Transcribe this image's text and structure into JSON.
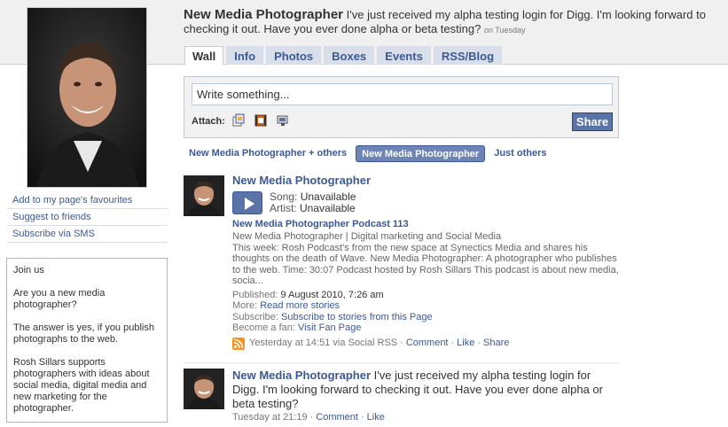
{
  "colors": {
    "link": "#3b5998",
    "tab_bg": "#d8dfea",
    "share_bg": "#5b74a8",
    "filter_active": "#6d84b4",
    "rss": "#f7931e"
  },
  "header": {
    "name": "New Media Photographer",
    "status": "I've just received my alpha testing login for Digg. I'm looking forward to checking it out. Have you ever done alpha or beta testing?",
    "time": "on Tuesday"
  },
  "tabs": [
    {
      "label": "Wall",
      "active": true
    },
    {
      "label": "Info"
    },
    {
      "label": "Photos"
    },
    {
      "label": "Boxes"
    },
    {
      "label": "Events"
    },
    {
      "label": "RSS/Blog"
    }
  ],
  "left": {
    "links": [
      "Add to my page's favourites",
      "Suggest to friends",
      "Subscribe via SMS"
    ],
    "join": {
      "title": "Join us",
      "q": "Are you a new media photographer?",
      "a": "The answer is yes, if you publish photographs to the web.",
      "desc": "Rosh Sillars supports photographers with ideas about social media, digital media and new marketing for the photographer."
    }
  },
  "composer": {
    "placeholder": "Write something...",
    "attach_label": "Attach:",
    "attach_icons": [
      "photo-icon",
      "video-icon",
      "link-icon"
    ],
    "share_label": "Share"
  },
  "filter": [
    "New Media Photographer + others",
    "New Media Photographer",
    "Just others"
  ],
  "stories": [
    {
      "name": "New Media Photographer",
      "song_label": "Song:",
      "song_value": "Unavailable",
      "artist_label": "Artist:",
      "artist_value": "Unavailable",
      "podcast_title": "New Media Photographer Podcast 113",
      "source": "New Media Photographer | Digital marketing and Social Media",
      "description": "This week: Rosh Podcast's from the new space at Synectics Media and shares his thoughts on the death of Wave. New Media Photographer: A photographer who publishes to the web. Time: 30:07 Podcast hosted by Rosh Sillars This podcast is about new media, socia...",
      "published_label": "Published:",
      "published_value": "9 August 2010, 7:26 am",
      "more_label": "More:",
      "more_value": "Read more stories",
      "subscribe_label": "Subscribe:",
      "subscribe_value": "Subscribe to stories from this Page",
      "fan_label": "Become a fan:",
      "fan_value": "Visit Fan Page",
      "footer_time": "Yesterday at 14:51 via Social RSS",
      "comment": "Comment",
      "like": "Like",
      "share": "Share"
    },
    {
      "name": "New Media Photographer",
      "text": "I've just received my alpha testing login for Digg. I'm looking forward to checking it out. Have you ever done alpha or beta testing?",
      "footer_time": "Tuesday at 21:19",
      "comment": "Comment",
      "like": "Like"
    }
  ]
}
